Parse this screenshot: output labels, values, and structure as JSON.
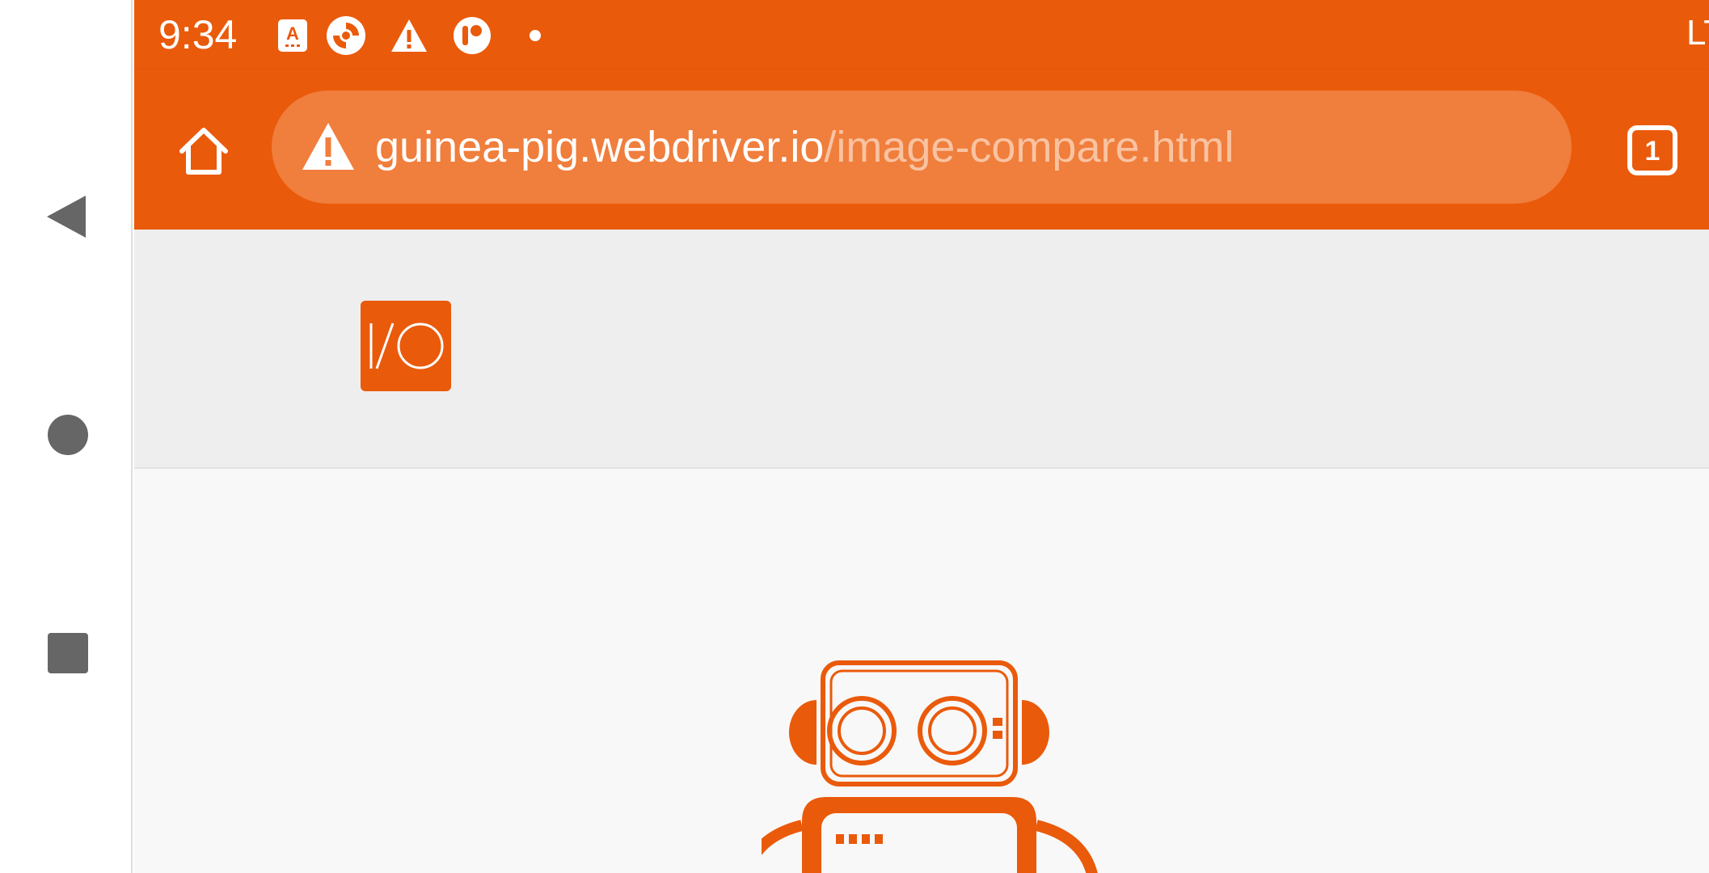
{
  "colors": {
    "brand": "#ea5a0b",
    "url_bar": "#f07e3c",
    "url_path": "#f9c3a2",
    "header_bg": "#eeeeee",
    "content_bg": "#f8f8f8"
  },
  "status_bar": {
    "time": "9:34",
    "icons": [
      "accessibility-a-icon",
      "sync-icon",
      "warning-icon",
      "app-circle-icon",
      "dot-icon"
    ],
    "network": "LT"
  },
  "browser": {
    "url_host": "guinea-pig.webdriver.io",
    "url_path": "/image-compare.html",
    "tab_count": "1"
  },
  "page": {
    "logo_text": "I/O",
    "hero_image": "webdriverio-robot"
  },
  "nav": {
    "buttons": [
      "back-icon",
      "home-circle-icon",
      "recents-square-icon"
    ]
  }
}
